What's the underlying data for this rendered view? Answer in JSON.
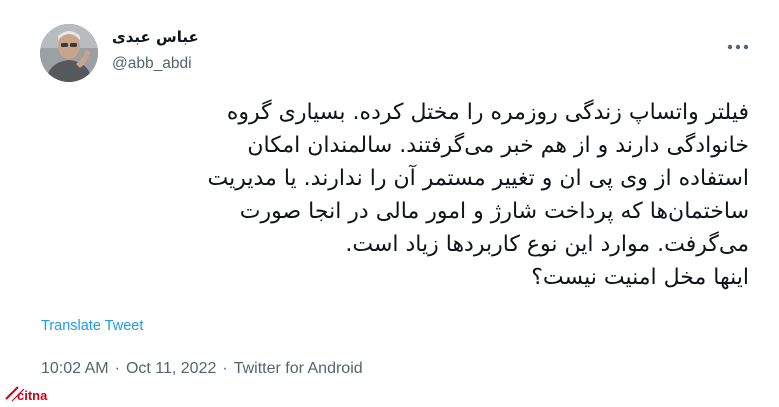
{
  "author": {
    "name": "عباس عبدی",
    "handle": "@abb_abdi"
  },
  "tweet": {
    "lines": [
      "فیلتر واتساپ زندگی روزمره را مختل کرده. بسیاری گروه",
      "خانوادگی دارند و از هم خبر می‌گرفتند. سالمندان امکان",
      "استفاده از وی پی ان و تغییر مستمر آن را ندارند. یا مدیریت",
      "ساختمان‌ها که پرداخت شارژ و امور مالی در انجا صورت",
      "می‌گرفت. موارد این نوع کاربردها زیاد است.",
      "اینها مخل امنیت نیست؟"
    ],
    "translate_label": "Translate Tweet"
  },
  "meta": {
    "time": "10:02 AM",
    "separator": "·",
    "date": "Oct 11, 2022",
    "source": "Twitter for Android"
  },
  "watermark": {
    "text": "citna"
  },
  "icons": {
    "more": "more-horizontal-icon",
    "avatar": "profile-photo"
  },
  "colors": {
    "link": "#1d9bf0",
    "secondary_text": "#536471",
    "primary_text": "#0f1419",
    "watermark": "#d0021b"
  }
}
